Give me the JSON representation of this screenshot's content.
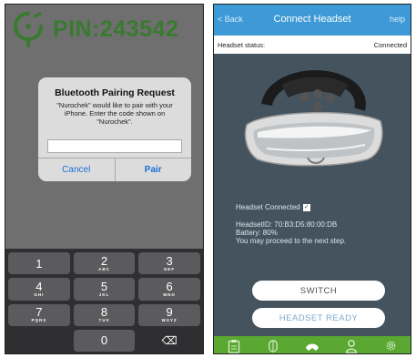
{
  "left": {
    "pin_label": "PIN:243542",
    "alert": {
      "title": "Bluetooth Pairing Request",
      "message": "\"Nurochek\" would like to pair with your iPhone. Enter the code shown on \"Nurochek\".",
      "input_value": "",
      "cancel_label": "Cancel",
      "pair_label": "Pair"
    },
    "keypad": [
      {
        "num": "1",
        "letters": ""
      },
      {
        "num": "2",
        "letters": "ABC"
      },
      {
        "num": "3",
        "letters": "DEF"
      },
      {
        "num": "4",
        "letters": "GHI"
      },
      {
        "num": "5",
        "letters": "JKL"
      },
      {
        "num": "6",
        "letters": "MNO"
      },
      {
        "num": "7",
        "letters": "PQRS"
      },
      {
        "num": "8",
        "letters": "TUV"
      },
      {
        "num": "9",
        "letters": "WXYZ"
      },
      {
        "num": "0",
        "letters": ""
      }
    ],
    "delete_icon": "⌫"
  },
  "right": {
    "nav": {
      "back": "< Back",
      "title": "Connect Headset",
      "help": "help"
    },
    "status": {
      "label": "Headset status:",
      "value": "Connected"
    },
    "info": {
      "connected_text": "Headset Connected",
      "check": "✓",
      "headset_id": "HeadsetID: 70:B3:D5:80:00:DB",
      "battery": "Battery: 80%",
      "proceed": "You may proceed to the next step."
    },
    "switch_label": "SWITCH",
    "ready_label": "HEADSET READY",
    "tabs": [
      "clipboard-icon",
      "brain-icon",
      "headset-icon",
      "person-icon",
      "gear-icon"
    ]
  },
  "colors": {
    "pin_green": "#3a7a30",
    "nav_blue": "#3e9ad6",
    "tab_green": "#5aa832",
    "panel_slate": "#44535e",
    "ios_blue": "#1b6fd8"
  }
}
